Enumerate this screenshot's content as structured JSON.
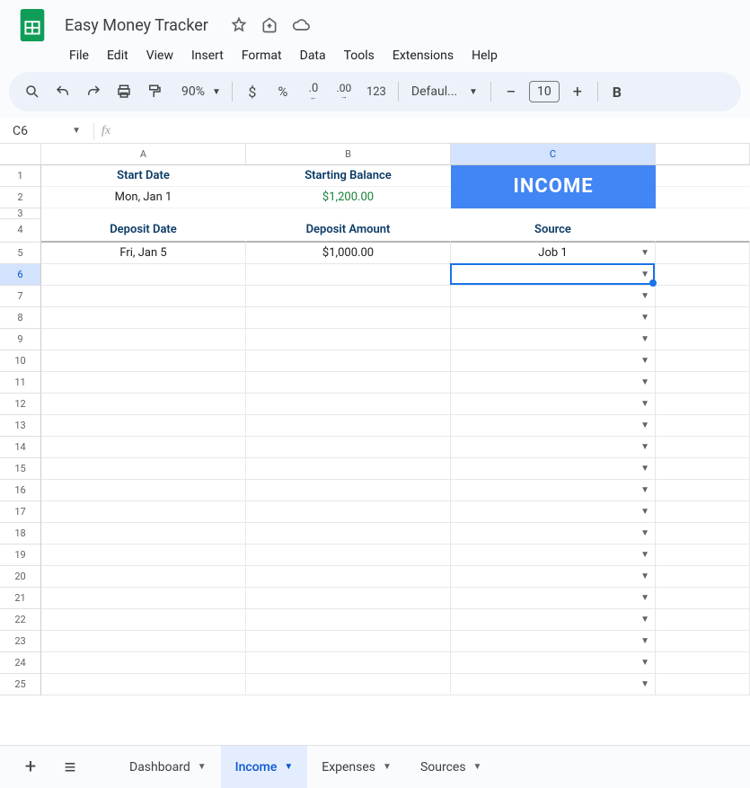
{
  "doc": {
    "title": "Easy Money Tracker"
  },
  "menus": [
    "File",
    "Edit",
    "View",
    "Insert",
    "Format",
    "Data",
    "Tools",
    "Extensions",
    "Help"
  ],
  "toolbar": {
    "zoom": "90%",
    "font": "Defaul...",
    "font_size": "10",
    "currency_hint": "$",
    "percent_hint": "%",
    "dec_dec": ".0",
    "dec_inc": ".00",
    "numfmt": "123",
    "bold": "B"
  },
  "name_box": "C6",
  "formula": "",
  "columns": {
    "A": "A",
    "B": "B",
    "C": "C"
  },
  "grid": {
    "header1": {
      "A": "Start Date",
      "B": "Starting Balance"
    },
    "banner": "INCOME",
    "row2": {
      "A": "Mon, Jan 1",
      "B": "$1,200.00"
    },
    "header4": {
      "A": "Deposit Date",
      "B": "Deposit Amount",
      "C": "Source"
    },
    "row5": {
      "A": "Fri, Jan 5",
      "B": "$1,000.00",
      "C": "Job 1"
    }
  },
  "row_labels": [
    "1",
    "2",
    "3",
    "4",
    "5",
    "6",
    "7",
    "8",
    "9",
    "10",
    "11",
    "12",
    "13",
    "14",
    "15",
    "16",
    "17",
    "18",
    "19",
    "20",
    "21",
    "22",
    "23",
    "24",
    "25"
  ],
  "tabs": [
    {
      "label": "Dashboard",
      "active": false
    },
    {
      "label": "Income",
      "active": true
    },
    {
      "label": "Expenses",
      "active": false
    },
    {
      "label": "Sources",
      "active": false
    }
  ]
}
